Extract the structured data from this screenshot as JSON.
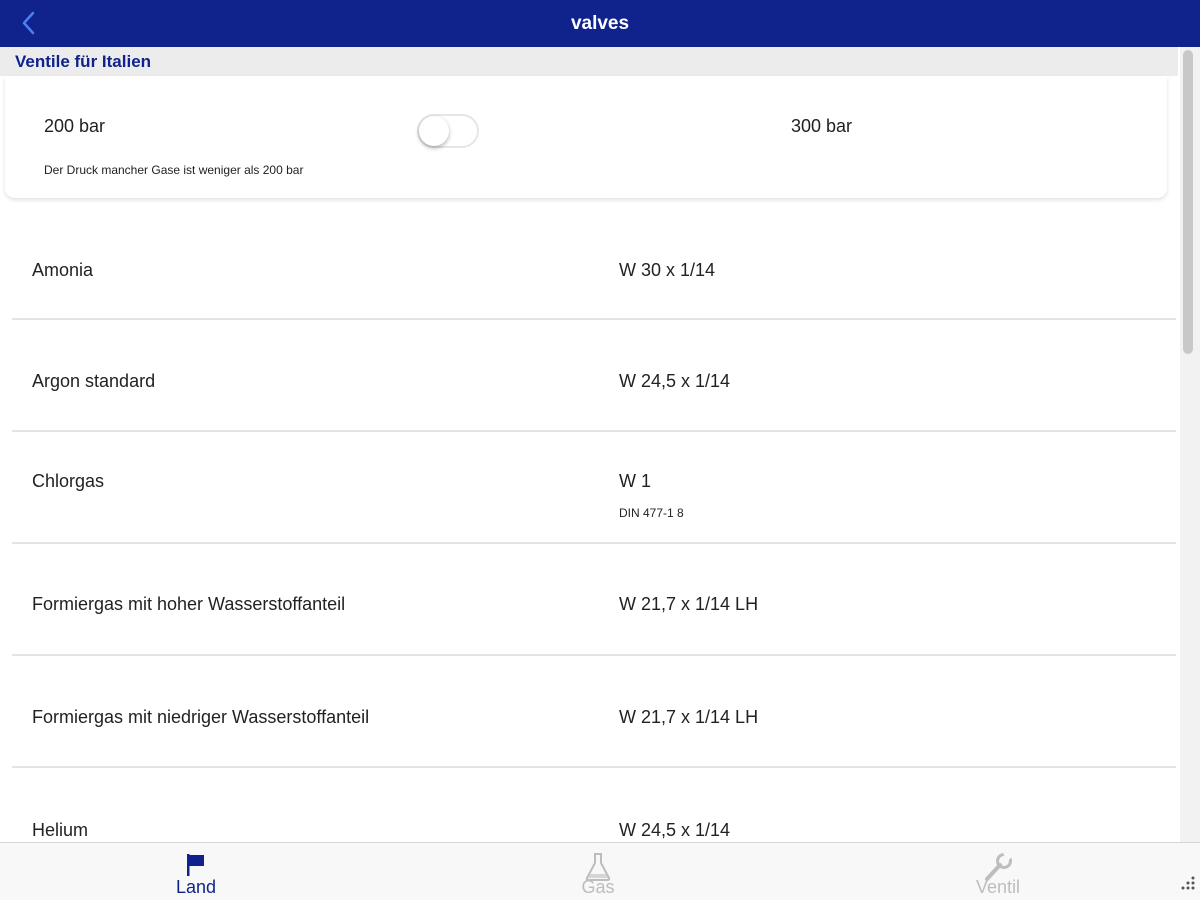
{
  "header": {
    "title": "valves",
    "back_icon": "chevron-left-icon"
  },
  "section": {
    "title": "Ventile für Italien"
  },
  "pressure": {
    "low_label": "200 bar",
    "high_label": "300 bar",
    "note": "Der Druck mancher Gase ist weniger als 200 bar",
    "toggle_on": false
  },
  "valves": [
    {
      "gas": "Amonia",
      "spec": "W 30 x 1/14",
      "norm": ""
    },
    {
      "gas": "Argon standard",
      "spec": "W 24,5 x 1/14",
      "norm": ""
    },
    {
      "gas": "Chlorgas",
      "spec": "W 1",
      "norm": "DIN 477-1 8"
    },
    {
      "gas": "Formiergas mit hoher Wasserstoffanteil",
      "spec": "W 21,7 x 1/14 LH",
      "norm": ""
    },
    {
      "gas": "Formiergas mit niedriger Wasserstoffanteil",
      "spec": "W 21,7 x 1/14 LH",
      "norm": ""
    },
    {
      "gas": "Helium",
      "spec": "W 24,5 x 1/14",
      "norm": ""
    }
  ],
  "tabs": [
    {
      "label": "Land",
      "icon": "flag-icon",
      "active": true
    },
    {
      "label": "Gas",
      "icon": "flask-icon",
      "active": false
    },
    {
      "label": "Ventil",
      "icon": "wrench-icon",
      "active": false
    }
  ],
  "colors": {
    "brand": "#10238c",
    "inactive_tab": "#bdbdbd",
    "section_bg": "#ececec"
  }
}
